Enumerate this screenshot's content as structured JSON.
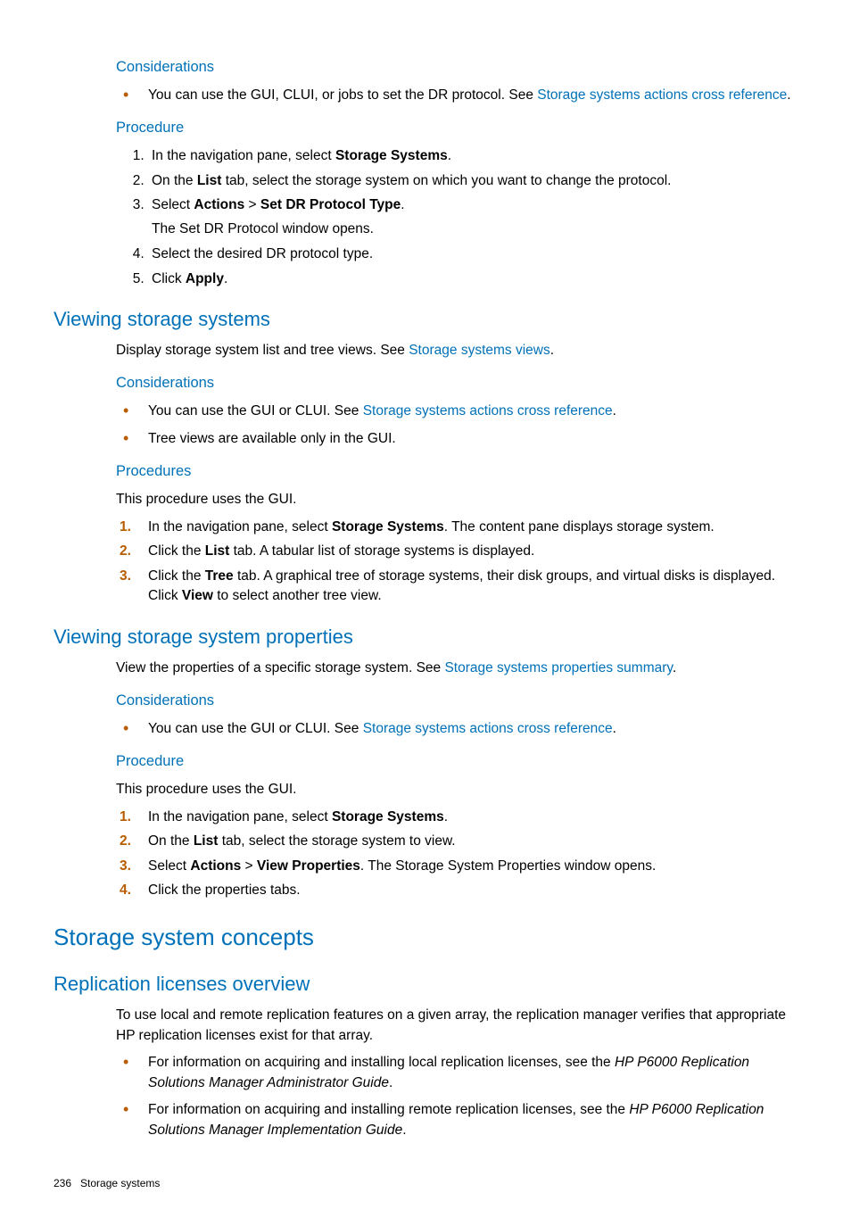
{
  "s1": {
    "considerations_h": "Considerations",
    "b1_a": "You can use the GUI, CLUI, or jobs to set the DR protocol. See ",
    "b1_link": "Storage systems actions cross reference",
    "b1_b": ".",
    "procedure_h": "Procedure",
    "p1_a": "In the navigation pane, select ",
    "p1_b": "Storage Systems",
    "p1_c": ".",
    "p2_a": "On the ",
    "p2_b": "List",
    "p2_c": " tab, select the storage system on which you want to change the protocol.",
    "p3_a": "Select ",
    "p3_b": "Actions",
    "p3_c": " > ",
    "p3_d": "Set DR Protocol Type",
    "p3_e": ".",
    "p3_sub": "The Set DR Protocol window opens.",
    "p4": "Select the desired DR protocol type.",
    "p5_a": "Click ",
    "p5_b": "Apply",
    "p5_c": "."
  },
  "s2": {
    "title": "Viewing storage systems",
    "intro_a": "Display storage system list and tree views. See ",
    "intro_link": "Storage systems views",
    "intro_b": ".",
    "considerations_h": "Considerations",
    "c1_a": "You can use the GUI or CLUI. See ",
    "c1_link": "Storage systems actions cross reference",
    "c1_b": ".",
    "c2": "Tree views are available only in the GUI.",
    "procedures_h": "Procedures",
    "procnote": "This procedure uses the GUI.",
    "p1_a": "In the navigation pane, select ",
    "p1_b": "Storage Systems",
    "p1_c": ". The content pane displays storage system.",
    "p2_a": "Click the ",
    "p2_b": "List",
    "p2_c": " tab. A tabular list of storage systems is displayed.",
    "p3_a": "Click the ",
    "p3_b": "Tree",
    "p3_c": " tab. A graphical tree of storage systems, their disk groups, and virtual disks is displayed. Click ",
    "p3_d": "View",
    "p3_e": " to select another tree view."
  },
  "s3": {
    "title": "Viewing storage system properties",
    "intro_a": "View the properties of a specific storage system. See ",
    "intro_link": "Storage systems properties summary",
    "intro_b": ".",
    "considerations_h": "Considerations",
    "c1_a": "You can use the GUI or CLUI. See ",
    "c1_link": "Storage systems actions cross reference",
    "c1_b": ".",
    "procedure_h": "Procedure",
    "procnote": "This procedure uses the GUI.",
    "p1_a": "In the navigation pane, select ",
    "p1_b": "Storage Systems",
    "p1_c": ".",
    "p2_a": "On the ",
    "p2_b": "List",
    "p2_c": " tab, select the storage system to view.",
    "p3_a": "Select ",
    "p3_b": "Actions",
    "p3_c": " > ",
    "p3_d": "View Properties",
    "p3_e": ". The Storage System Properties window opens.",
    "p4": "Click the properties tabs."
  },
  "s4": {
    "title": "Storage system concepts"
  },
  "s5": {
    "title": "Replication licenses overview",
    "intro": "To use local and remote replication features on a given array, the replication manager verifies that appropriate HP replication licenses exist for that array.",
    "b1_a": "For information on acquiring and installing local replication licenses, see the ",
    "b1_i": "HP P6000 Replication Solutions Manager Administrator Guide",
    "b1_b": ".",
    "b2_a": "For information on acquiring and installing remote replication licenses, see the ",
    "b2_i": "HP P6000 Replication Solutions Manager Implementation Guide",
    "b2_b": "."
  },
  "footer": {
    "page": "236",
    "chapter": "Storage systems"
  }
}
